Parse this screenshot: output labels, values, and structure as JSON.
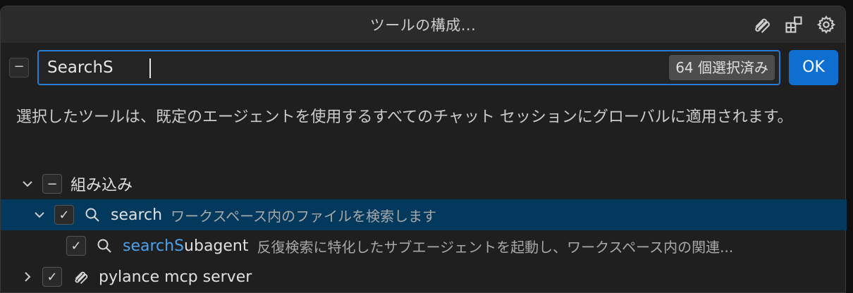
{
  "dialog": {
    "title": "ツールの構成...",
    "collapse_all_symbol": "−",
    "search": {
      "value": "SearchS",
      "placeholder": "",
      "selected_count": "64 個選択済み"
    },
    "ok_label": "OK",
    "description": "選択したツールは、既定のエージェントを使用するすべてのチャット セッションにグローバルに適用されます。"
  },
  "tree": {
    "builtin": {
      "label": "組み込み",
      "state_symbol": "−"
    },
    "search": {
      "label": "search",
      "description": "ワークスペース内のファイルを検索します",
      "check_symbol": "✓"
    },
    "subagent": {
      "label_match": "searchS",
      "label_rest": "ubagent",
      "description": "反復検索に特化したサブエージェントを起動し、ワークスペース内の関連...",
      "check_symbol": "✓"
    },
    "pylance": {
      "label": "pylance mcp server",
      "check_symbol": "✓"
    }
  },
  "colors": {
    "accent": "#0e6fd1",
    "focus_border": "#2b7bd6",
    "selected_row": "#04395e",
    "match_highlight": "#4aa3f0"
  }
}
